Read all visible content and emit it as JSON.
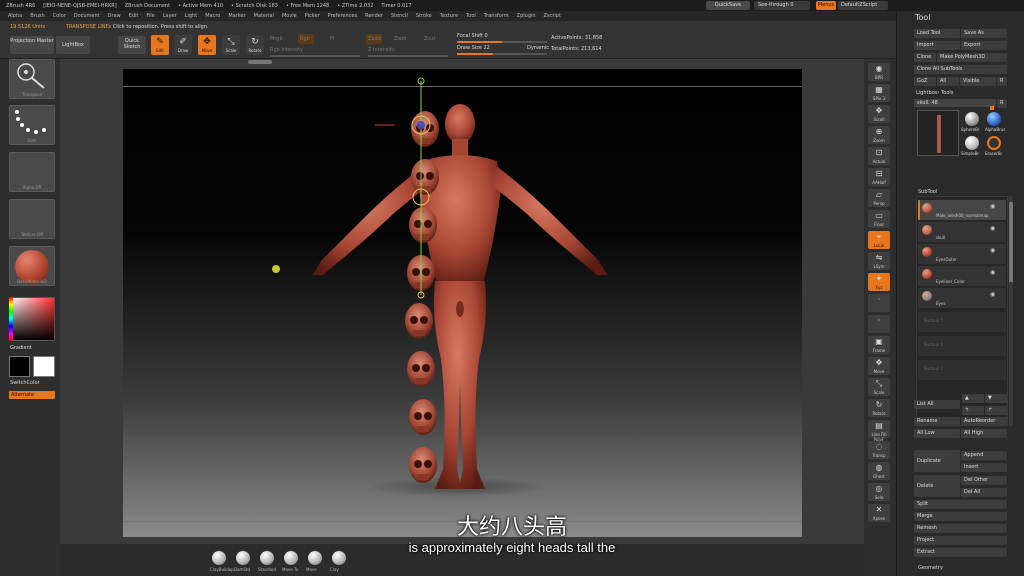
{
  "titlebar": {
    "app": "ZBrush 4R6",
    "build": "[IEIO-NENE-QJSB-EMEI-HRKR]",
    "doc": "ZBrush Document",
    "active_mem": "• Active Mem 410",
    "scratch": "• Scratch Disk 183",
    "free_mem": "• Free Mem 1248",
    "ztime": "• ZTime 2.032",
    "timer": "Timer 0.017",
    "quicksave": "QuickSave",
    "see_through": "See-through  0",
    "menus": "Menus",
    "default_script": "DefaultZScript"
  },
  "menubar": [
    "Alpha",
    "Brush",
    "Color",
    "Document",
    "Draw",
    "Edit",
    "File",
    "Layer",
    "Light",
    "Macro",
    "Marker",
    "Material",
    "Movie",
    "Picker",
    "Preferences",
    "Render",
    "Stencil",
    "Stroke",
    "Texture",
    "Tool",
    "Transform",
    "Zplugin",
    "Zscript"
  ],
  "toolbar": {
    "units": "19.5126 Units",
    "transpose_hint_b": "TRANSPOSE LINEs",
    "transpose_hint": "Click to reposition. Press shift to align.",
    "projection_master": "Projection Master",
    "lightbox": "LightBox",
    "quick_sketch": "Quick Sketch",
    "edit": "Edit",
    "draw": "Draw",
    "move": "Move",
    "scale": "Scale",
    "rotate": "Rotate",
    "mrgb": "Mrgb",
    "rgb": "Rgb",
    "m": "M",
    "zadd": "Zadd",
    "zsub": "Zsub",
    "zcut": "Zcut",
    "rgb_intensity": "Rgb Intensity",
    "z_intensity": "Z Intensity",
    "focal_shift": "Focal Shift 0",
    "draw_size": "Draw Size 22",
    "dynamic": "Dynamic",
    "active_points": "ActivePoints: 31,858",
    "total_points": "TotalPoints: 213,614"
  },
  "leftpanel": {
    "brush_caption": "Transpose",
    "stroke_caption": "Dots",
    "alpha_caption": "Alpha Off",
    "texture_caption": "Texture Off",
    "material_caption": "BasicMaterial2",
    "gradient": "Gradient",
    "switch_color": "SwitchColor",
    "alternate": "Alternate"
  },
  "subtitles": {
    "zh": "大约八头高",
    "en": "is approximately eight heads tall the"
  },
  "bottom_brushes": [
    "ClayBuildup",
    "DamStd",
    "Standard",
    "Move To",
    "Move",
    "Clay"
  ],
  "rightshelf": [
    "BPR",
    "SPix 3",
    "Scroll",
    "Zoom",
    "Actual",
    "AAHalf",
    "Persp",
    "Floor",
    "Local",
    "LSym",
    "Xyz",
    "",
    "",
    "Frame",
    "Move",
    "Scale",
    "Rotate",
    "Line Fill PolyF",
    "Transp",
    "Ghost",
    "Solo",
    "Xpose"
  ],
  "tool": {
    "title": "Tool",
    "load_tool": "Load Tool",
    "save_as": "Save As",
    "import": "Import",
    "export": "Export",
    "clone": "Clone",
    "make_polymesh": "Make PolyMesh3D",
    "clone_all_subtools": "Clone All SubTools",
    "goz": "GoZ",
    "all": "All",
    "visible": "Visible",
    "r": "R",
    "lightbox_tools": "Lightbox› Tools",
    "skull_slider": "skull. 48",
    "r2": "R",
    "thumb_labels": [
      "SphereBr",
      "AlphaBrus",
      "SimpleBr",
      "EraserBr"
    ],
    "subtool_header": "SubTool",
    "subtools": [
      "Male_mesh00_normalmap",
      "skull",
      "EyesOuter",
      "Eyeliner_Color",
      "Eyes"
    ],
    "empty_slots": [
      "Subtool 5",
      "Subtool 6",
      "Subtool 7"
    ],
    "list_all": "List All",
    "rename": "Rename",
    "autoreorder": "AutoReorder",
    "all_low": "All Low",
    "all_high": "All High",
    "duplicate": "Duplicate",
    "append": "Append",
    "insert": "Insert",
    "delete": "Delete",
    "del_other": "Del Other",
    "del_all": "Del All",
    "split": "Split",
    "merge": "Merge",
    "remesh": "Remesh",
    "project": "Project",
    "extract": "Extract",
    "geometry": "Geometry"
  },
  "colors": {
    "accent": "#e8761c",
    "skin": "#b3503c",
    "panel": "#2e2e2e"
  }
}
